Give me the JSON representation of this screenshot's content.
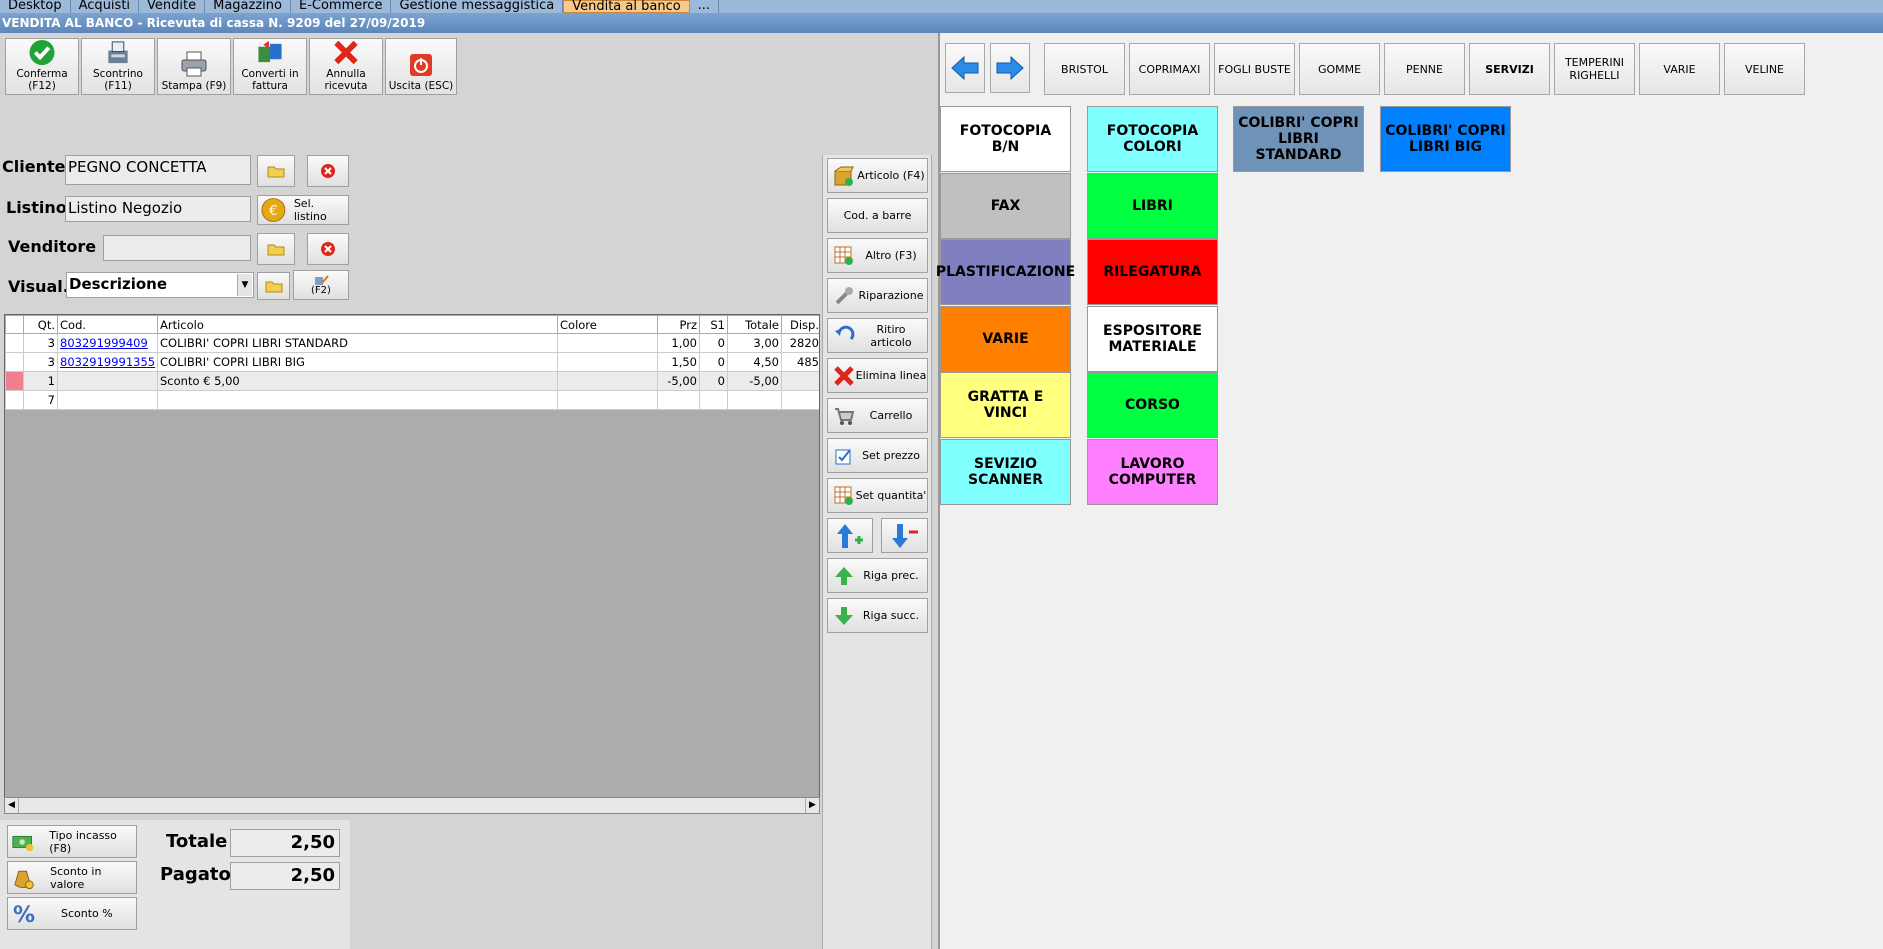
{
  "tabs": [
    "Desktop",
    "Acquisti",
    "Vendite",
    "Magazzino",
    "E-Commerce",
    "Gestione messaggistica",
    "Vendita al banco",
    "..."
  ],
  "window_title": "VENDITA AL BANCO - Ricevuta di cassa N. 9209 del 27/09/2019",
  "toolbar": {
    "conferma": "Conferma (F12)",
    "scontrino": "Scontrino (F11)",
    "stampa": "Stampa (F9)",
    "converti": "Converti in fattura",
    "annulla": "Annulla ricevuta",
    "uscita": "Uscita (ESC)"
  },
  "form": {
    "cliente_label": "Cliente",
    "cliente_value": "PEGNO CONCETTA",
    "listino_label": "Listino",
    "listino_value": "Listino Negozio",
    "sel_listino": "Sel. listino",
    "venditore_label": "Venditore",
    "venditore_value": "",
    "visual_label": "Visual.",
    "visual_value": "Descrizione",
    "f2_label": "(F2)"
  },
  "grid": {
    "headers": [
      "",
      "Qt.",
      "Cod.",
      "Articolo",
      "Colore",
      "Prz",
      "S1",
      "Totale",
      "Disp."
    ],
    "rows": [
      {
        "qt": "3",
        "cod": "803291999409",
        "articolo": "COLIBRI' COPRI LIBRI STANDARD",
        "colore": "",
        "prz": "1,00",
        "s1": "0",
        "totale": "3,00",
        "disp": "2820"
      },
      {
        "qt": "3",
        "cod": "8032919991355",
        "articolo": "COLIBRI' COPRI LIBRI BIG",
        "colore": "",
        "prz": "1,50",
        "s1": "0",
        "totale": "4,50",
        "disp": "485"
      },
      {
        "qt": "1",
        "cod": "",
        "articolo": "Sconto € 5,00",
        "colore": "",
        "prz": "-5,00",
        "s1": "0",
        "totale": "-5,00",
        "disp": ""
      },
      {
        "qt": "7",
        "cod": "",
        "articolo": "",
        "colore": "",
        "prz": "",
        "s1": "",
        "totale": "",
        "disp": ""
      }
    ]
  },
  "side_buttons": {
    "articolo": "Articolo (F4)",
    "cod_barre": "Cod. a barre",
    "altro": "Altro (F3)",
    "riparazione": "Riparazione",
    "ritiro": "Ritiro articolo",
    "elimina": "Elimina linea",
    "carrello": "Carrello",
    "set_prezzo": "Set prezzo",
    "set_quantita": "Set quantita'",
    "riga_prec": "Riga prec.",
    "riga_succ": "Riga succ."
  },
  "totals": {
    "tipo_incasso": "Tipo incasso (F8)",
    "sconto_valore": "Sconto in valore",
    "sconto_perc": "Sconto %",
    "totale_label": "Totale",
    "totale_value": "2,50",
    "pagato_label": "Pagato",
    "pagato_value": "2,50"
  },
  "categories": [
    "BRISTOL",
    "COPRIMAXI",
    "FOGLI BUSTE",
    "GOMME",
    "PENNE",
    "SERVIZI",
    "TEMPERINI RIGHELLI",
    "VARIE",
    "VELINE"
  ],
  "active_category": "SERVIZI",
  "products": [
    {
      "label": "FOTOCOPIA B/N",
      "color": "#ffffff"
    },
    {
      "label": "FOTOCOPIA COLORI",
      "color": "#80ffff"
    },
    {
      "label": "COLIBRI' COPRI LIBRI STANDARD",
      "color": "#6f93b8"
    },
    {
      "label": "COLIBRI' COPRI LIBRI BIG",
      "color": "#0080ff"
    },
    {
      "label": "FAX",
      "color": "#c0c0c0"
    },
    {
      "label": "LIBRI",
      "color": "#00ff40"
    },
    {
      "label": "PLASTIFICAZIONE",
      "color": "#8080c0"
    },
    {
      "label": "RILEGATURA",
      "color": "#ff0000"
    },
    {
      "label": "VARIE",
      "color": "#ff8000"
    },
    {
      "label": "ESPOSITORE MATERIALE",
      "color": "#ffffff"
    },
    {
      "label": "GRATTA E VINCI",
      "color": "#ffff80"
    },
    {
      "label": "CORSO",
      "color": "#00ff40"
    },
    {
      "label": "SEVIZIO SCANNER",
      "color": "#80ffff"
    },
    {
      "label": "LAVORO COMPUTER",
      "color": "#ff80ff"
    }
  ]
}
